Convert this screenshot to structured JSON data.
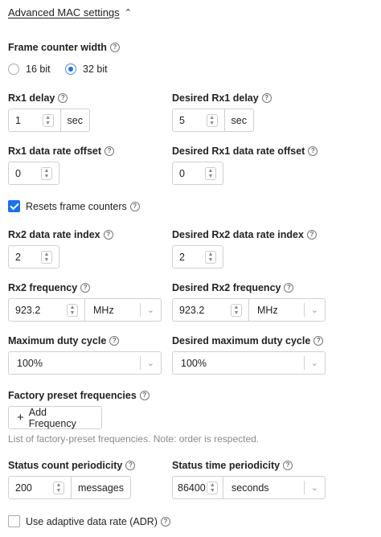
{
  "section": {
    "title": "Advanced MAC settings",
    "chevron": "chevron-up-icon"
  },
  "frame_counter_width": {
    "label": "Frame counter width",
    "options": [
      "16 bit",
      "32 bit"
    ],
    "selected": "32 bit"
  },
  "rx1_delay": {
    "label": "Rx1 delay",
    "value": "1",
    "unit": "sec"
  },
  "desired_rx1_delay": {
    "label": "Desired Rx1 delay",
    "value": "5",
    "unit": "sec"
  },
  "rx1_data_rate_offset": {
    "label": "Rx1 data rate offset",
    "value": "0"
  },
  "desired_rx1_data_rate_offset": {
    "label": "Desired Rx1 data rate offset",
    "value": "0"
  },
  "resets_frame_counters": {
    "label": "Resets frame counters",
    "checked": true
  },
  "rx2_data_rate_index": {
    "label": "Rx2 data rate index",
    "value": "2"
  },
  "desired_rx2_data_rate_index": {
    "label": "Desired Rx2 data rate index",
    "value": "2"
  },
  "rx2_frequency": {
    "label": "Rx2 frequency",
    "value": "923.2",
    "unit": "MHz"
  },
  "desired_rx2_frequency": {
    "label": "Desired Rx2 frequency",
    "value": "923.2",
    "unit": "MHz"
  },
  "maximum_duty_cycle": {
    "label": "Maximum duty cycle",
    "value": "100%"
  },
  "desired_maximum_duty_cycle": {
    "label": "Desired maximum duty cycle",
    "value": "100%"
  },
  "factory_preset_frequencies": {
    "label": "Factory preset frequencies",
    "button": "Add Frequency",
    "note": "List of factory-preset frequencies. Note: order is respected."
  },
  "status_count_periodicity": {
    "label": "Status count periodicity",
    "value": "200",
    "unit": "messages"
  },
  "status_time_periodicity": {
    "label": "Status time periodicity",
    "value": "86400",
    "unit": "seconds"
  },
  "adr": {
    "label": "Use adaptive data rate (ADR)",
    "checked": false
  },
  "colors": {
    "accent": "#1a73e8",
    "border": "#d0d0d0",
    "muted_text": "#8a8a8a"
  }
}
